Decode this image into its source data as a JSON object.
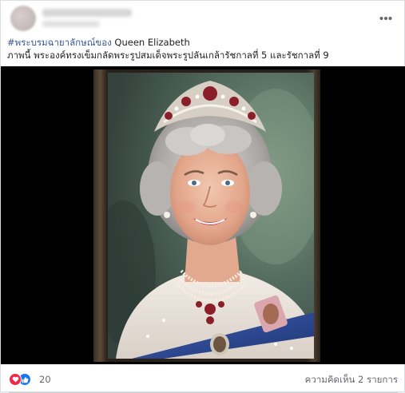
{
  "post": {
    "caption_hashtag": "#พระบรมฉายาลักษณ์ของ",
    "caption_line1_rest": " Queen Elizabeth",
    "caption_line2": "ภาพนี้ พระองค์ทรงเข็มกลัดพระรูปสมเด็จพระรูปลันเกล้ารัชกาลที่ 5 และรัชกาลที่ 9"
  },
  "footer": {
    "reaction_count": "20",
    "comments_label": "ความคิดเห็น 2 รายการ"
  },
  "icons": {
    "more": "more-horizontal-icon",
    "love": "heart-reaction-icon",
    "like": "thumbs-up-reaction-icon"
  },
  "colors": {
    "hashtag": "#385898",
    "like_blue": "#1877f2",
    "love_red": "#f0284a",
    "secondary_text": "#65676b"
  }
}
